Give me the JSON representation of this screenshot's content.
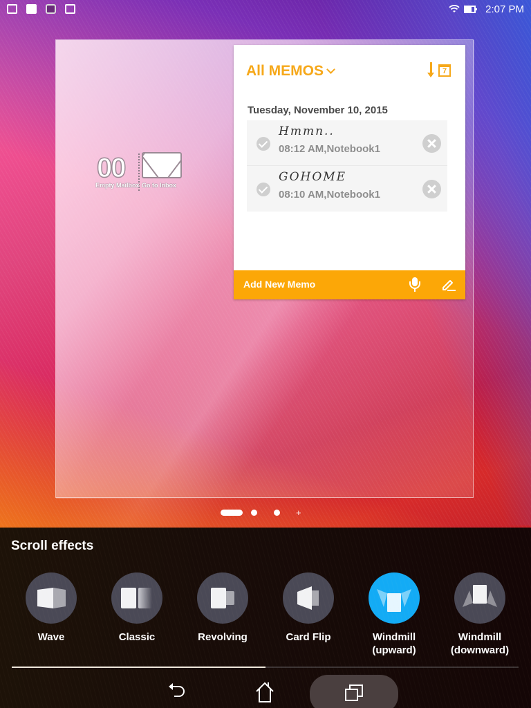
{
  "status_bar": {
    "notification_icons": [
      "gmail-icon",
      "photo-icon",
      "app-icon",
      "store-icon"
    ],
    "wifi": "wifi-icon",
    "battery": "battery-icon",
    "time": "2:07 PM"
  },
  "mail_widget": {
    "count": "00",
    "left_label": "Empty Mailbox",
    "right_label": "Go to Inbox"
  },
  "memo_widget": {
    "title": "All MEMOS",
    "sort_icon_day": "7",
    "date": "Tuesday, November 10, 2015",
    "memos": [
      {
        "handwriting": "Hmmn..",
        "meta": "08:12 AM,Notebook1"
      },
      {
        "handwriting": "GOHOME",
        "meta": "08:10 AM,Notebook1"
      }
    ],
    "footer_label": "Add New Memo",
    "accent_color": "#fca707"
  },
  "page_indicator": {
    "total_pages": 3,
    "current_page": 1
  },
  "scroll_effects": {
    "title": "Scroll effects",
    "selected_index": 4,
    "selected_color": "#13abf5",
    "items": [
      {
        "label": "Wave"
      },
      {
        "label": "Classic"
      },
      {
        "label": "Revolving"
      },
      {
        "label": "Card Flip"
      },
      {
        "label": "Windmill\n(upward)"
      },
      {
        "label": "Windmill\n(downward)"
      }
    ],
    "scroll_progress": 0.5
  },
  "nav_bar": {
    "back": "back-icon",
    "home": "home-icon",
    "recents": "recent-apps-icon"
  }
}
